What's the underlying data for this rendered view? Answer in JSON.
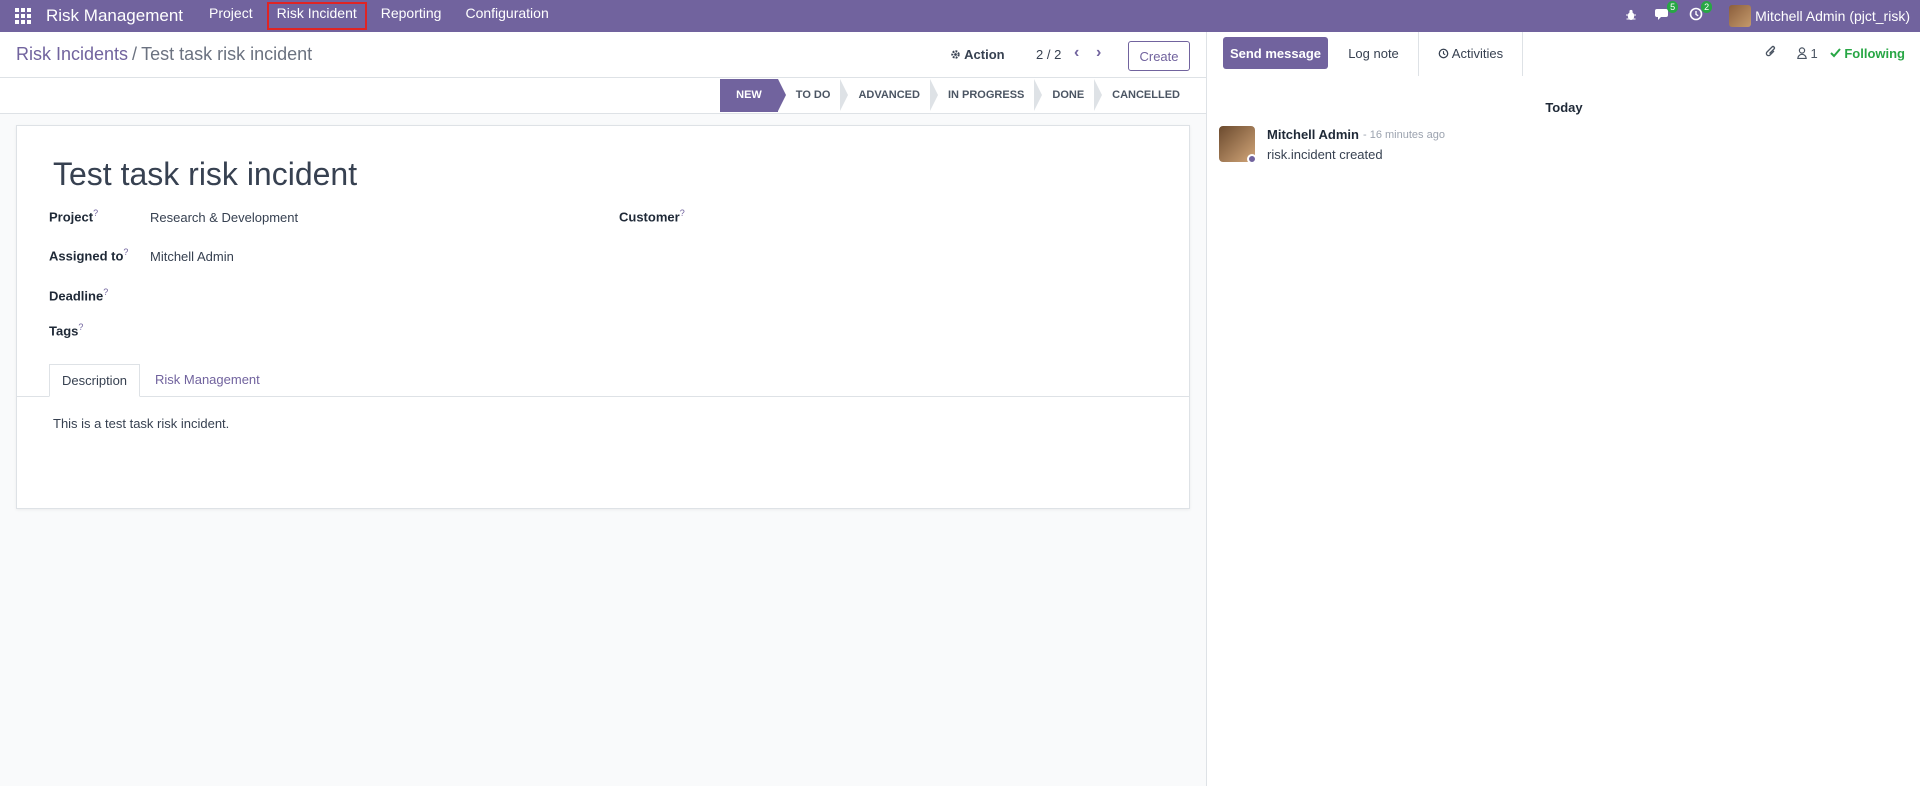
{
  "navbar": {
    "brand": "Risk Management",
    "menu": [
      "Project",
      "Risk Incident",
      "Reporting",
      "Configuration"
    ],
    "messages_badge": "5",
    "activities_badge": "2",
    "user": "Mitchell Admin (pjct_risk)"
  },
  "breadcrumb": {
    "parent": "Risk Incidents",
    "separator": "/",
    "current": "Test task risk incident"
  },
  "control": {
    "action_label": "Action",
    "pager": "2 / 2",
    "create_label": "Create"
  },
  "stages": [
    "NEW",
    "TO DO",
    "ADVANCED",
    "IN PROGRESS",
    "DONE",
    "CANCELLED"
  ],
  "active_stage": "NEW",
  "form": {
    "title": "Test task risk incident",
    "fields": {
      "project_label": "Project",
      "project_value": "Research & Development",
      "customer_label": "Customer",
      "assigned_label": "Assigned to",
      "assigned_value": "Mitchell Admin",
      "deadline_label": "Deadline",
      "tags_label": "Tags",
      "help_mark": "?"
    },
    "tabs": [
      "Description",
      "Risk Management"
    ],
    "description": "This is a test task risk incident."
  },
  "chatter": {
    "send_message": "Send message",
    "log_note": "Log note",
    "activities": "Activities",
    "followers_count": "1",
    "following": "Following",
    "date_separator": "Today",
    "message": {
      "author": "Mitchell Admin",
      "time": "- 16 minutes ago",
      "body": "risk.incident created"
    }
  },
  "colors": {
    "brand": "#71639e",
    "success": "#28a745",
    "highlight_box": "#e02424"
  }
}
